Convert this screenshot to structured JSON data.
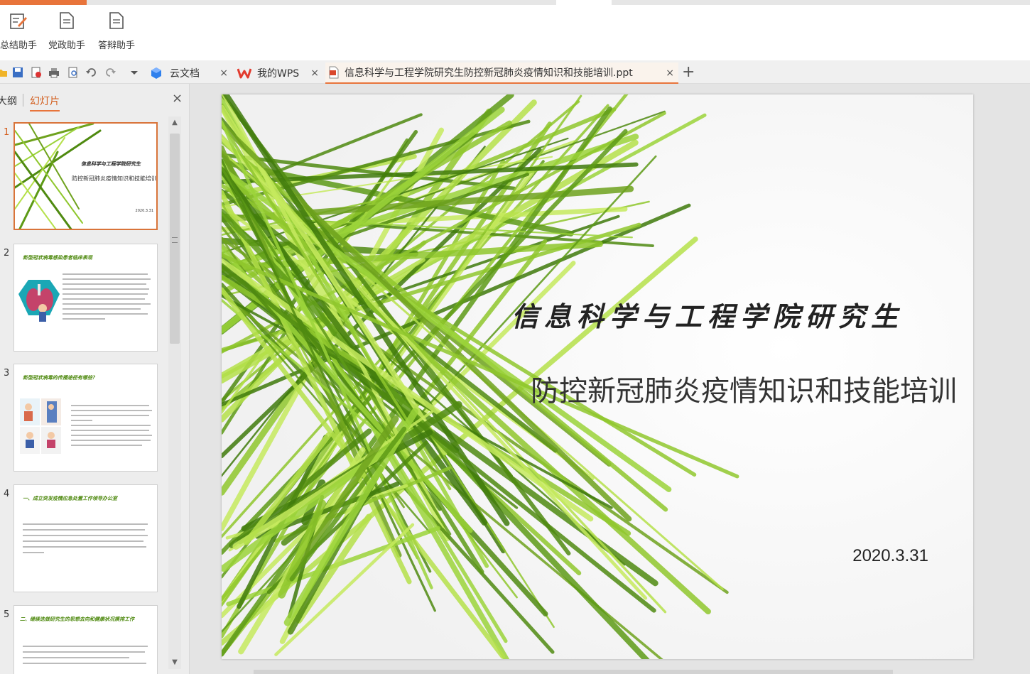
{
  "ribbon": {
    "buttons": [
      {
        "label": "总结助手",
        "icon": "pen-document-icon"
      },
      {
        "label": "党政助手",
        "icon": "document-icon"
      },
      {
        "label": "答辩助手",
        "icon": "document-icon"
      }
    ]
  },
  "quick_access": [
    "open-icon",
    "save-icon",
    "export-pdf-icon",
    "print-icon",
    "print-preview-icon",
    "undo-icon",
    "redo-icon",
    "dropdown-icon"
  ],
  "tabs": [
    {
      "label": "云文档",
      "icon": "cube-icon",
      "close": "×"
    },
    {
      "label": "我的WPS",
      "icon": "wps-logo-icon",
      "close": "×"
    },
    {
      "label": "信息科学与工程学院研究生防控新冠肺炎疫情知识和技能培训.ppt",
      "icon": "ppt-file-icon",
      "close": "×",
      "active": true
    }
  ],
  "newtab_label": "+",
  "panel": {
    "tab_outline": "大纲",
    "tab_slides": "幻灯片",
    "close": "×"
  },
  "thumbnails": [
    {
      "num": "1",
      "title": "信息科学与工程学院研究生",
      "subtitle": "防控新冠肺炎疫情知识和技能培训",
      "date": "2020.3.31"
    },
    {
      "num": "2",
      "title": "新型冠状病毒感染患者临床表现"
    },
    {
      "num": "3",
      "title": "新型冠状病毒的传播途径有哪些?"
    },
    {
      "num": "4",
      "title": "一、成立突发疫情应急处置工作领导办公室"
    },
    {
      "num": "5",
      "title": "二、继续迭做研究生的思想去向和健康状况摸排工作"
    }
  ],
  "slide": {
    "title": "信息科学与工程学院研究生",
    "subtitle": "防控新冠肺炎疫情知识和技能培训",
    "date": "2020.3.31"
  },
  "colors": {
    "accent": "#e8743b",
    "leaf_dark": "#4f8a10",
    "leaf_light": "#b5e04a"
  }
}
